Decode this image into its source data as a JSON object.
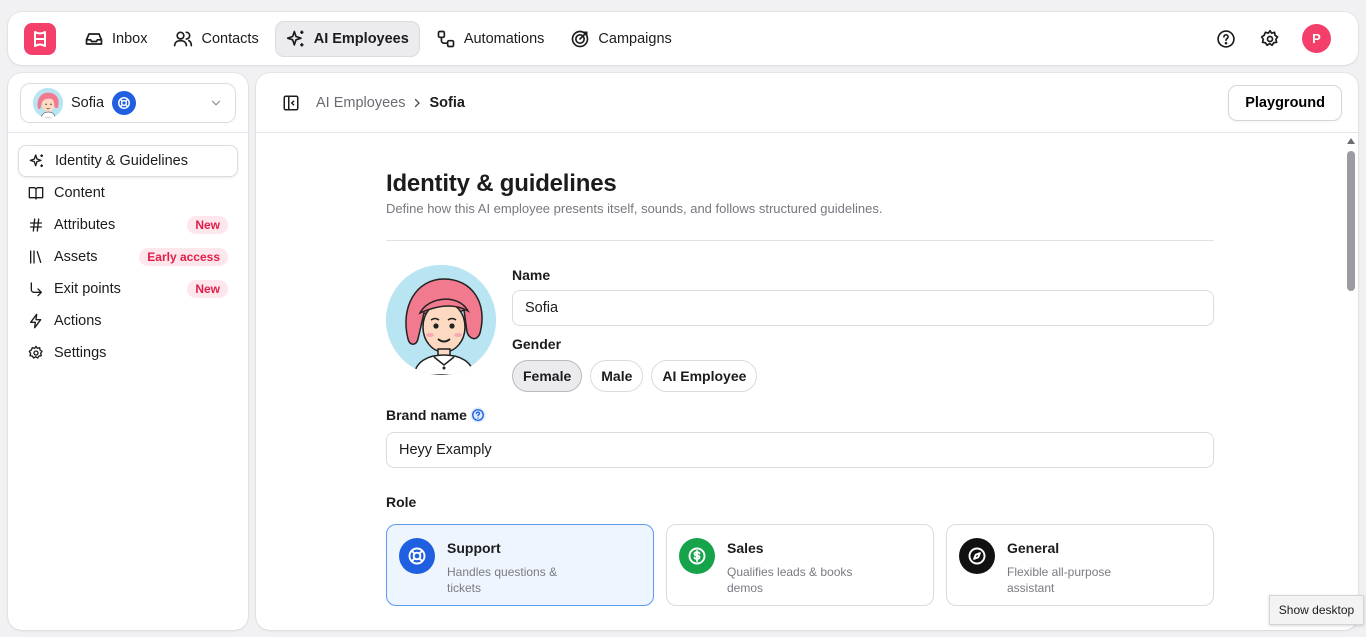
{
  "nav": {
    "items": [
      {
        "label": "Inbox",
        "icon": "inbox-icon"
      },
      {
        "label": "Contacts",
        "icon": "contacts-icon"
      },
      {
        "label": "AI Employees",
        "icon": "sparkles-icon",
        "active": true
      },
      {
        "label": "Automations",
        "icon": "automations-icon"
      },
      {
        "label": "Campaigns",
        "icon": "target-icon"
      }
    ],
    "avatar_initial": "P",
    "accent": "#f43f6b"
  },
  "sidebar": {
    "employee_name": "Sofia",
    "items": [
      {
        "label": "Identity & Guidelines",
        "icon": "sparkles-icon",
        "active": true
      },
      {
        "label": "Content",
        "icon": "book-icon"
      },
      {
        "label": "Attributes",
        "icon": "hash-icon",
        "badge": "New"
      },
      {
        "label": "Assets",
        "icon": "library-icon",
        "badge": "Early access"
      },
      {
        "label": "Exit points",
        "icon": "corner-arrow-icon",
        "badge": "New"
      },
      {
        "label": "Actions",
        "icon": "bolt-icon"
      },
      {
        "label": "Settings",
        "icon": "gear-icon"
      }
    ]
  },
  "header": {
    "breadcrumb_parent": "AI Employees",
    "breadcrumb_current": "Sofia",
    "playground_label": "Playground"
  },
  "page": {
    "title": "Identity & guidelines",
    "subtitle": "Define how this AI employee presents itself, sounds, and follows structured guidelines.",
    "name_label": "Name",
    "name_value": "Sofia",
    "gender_label": "Gender",
    "gender_options": [
      "Female",
      "Male",
      "AI Employee"
    ],
    "gender_selected": "Female",
    "brand_label": "Brand name",
    "brand_value": "Heyy Examply",
    "role_label": "Role",
    "roles": [
      {
        "title": "Support",
        "desc": "Handles questions & tickets",
        "color": "#1f5fe0",
        "icon": "lifebuoy-icon",
        "selected": true
      },
      {
        "title": "Sales",
        "desc": "Qualifies leads & books demos",
        "color": "#16a34a",
        "icon": "dollar-icon"
      },
      {
        "title": "General",
        "desc": "Flexible all-purpose assistant",
        "color": "#111111",
        "icon": "compass-icon"
      }
    ]
  },
  "taskbar": {
    "show_desktop": "Show desktop"
  }
}
